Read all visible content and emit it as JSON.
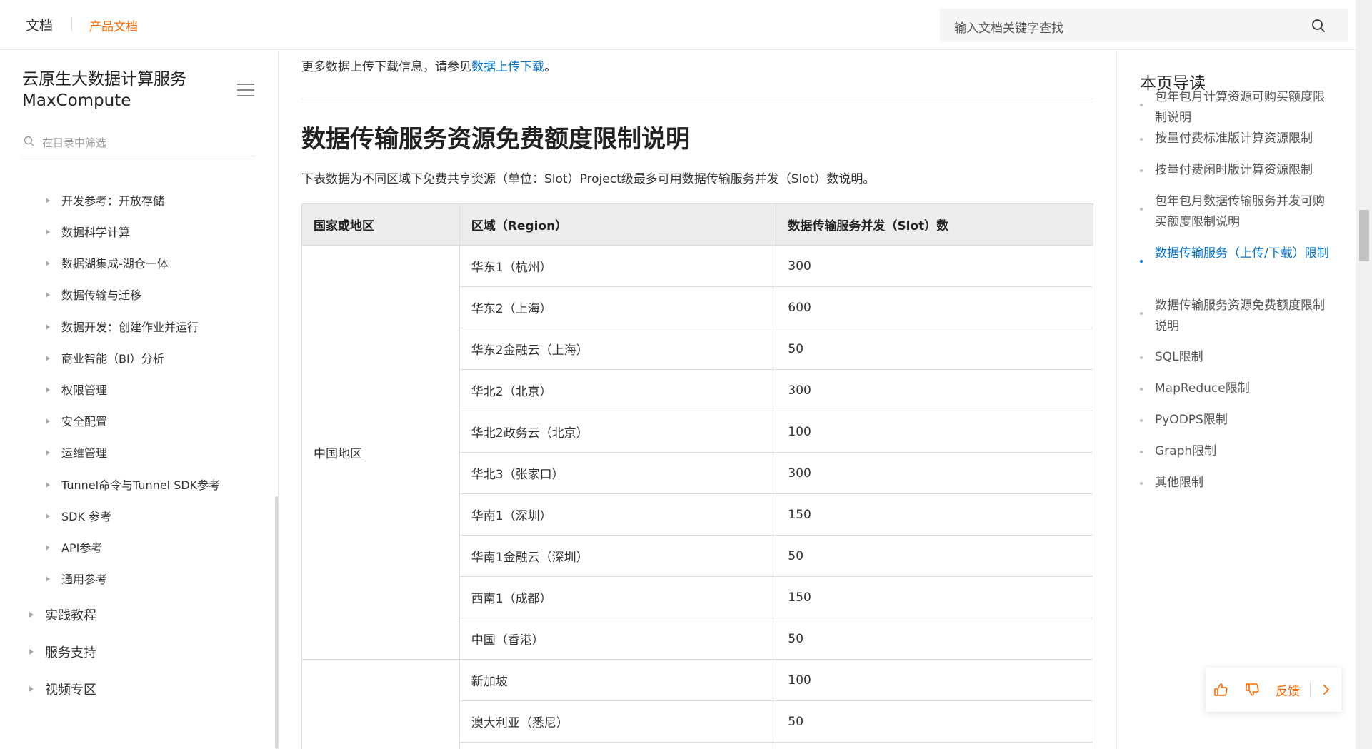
{
  "topbar": {
    "brand": "文档",
    "product": "产品文档",
    "search_placeholder": "输入文档关键字查找",
    "search_icon": "search-icon"
  },
  "sidebar": {
    "title_line1": "云原生大数据计算服务",
    "title_line2": "MaxCompute",
    "filter_placeholder": "在目录中筛选",
    "items": [
      {
        "label": "开发参考：开放存储"
      },
      {
        "label": "数据科学计算"
      },
      {
        "label": "数据湖集成-湖仓一体"
      },
      {
        "label": "数据传输与迁移"
      },
      {
        "label": "数据开发：创建作业并运行"
      },
      {
        "label": "商业智能（BI）分析"
      },
      {
        "label": "权限管理"
      },
      {
        "label": "安全配置"
      },
      {
        "label": "运维管理"
      },
      {
        "label": "Tunnel命令与Tunnel SDK参考"
      },
      {
        "label": "SDK 参考"
      },
      {
        "label": "API参考"
      },
      {
        "label": "通用参考"
      }
    ],
    "top_items": [
      {
        "label": "实践教程"
      },
      {
        "label": "服务支持"
      },
      {
        "label": "视频专区"
      }
    ]
  },
  "main": {
    "more_prefix": "更多数据上传下载信息，请参见",
    "more_link": "数据上传下载",
    "more_suffix": "。",
    "heading": "数据传输服务资源免费额度限制说明",
    "description": "下表数据为不同区域下免费共享资源（单位：Slot）Project级最多可用数据传输服务并发（Slot）数说明。",
    "table": {
      "headers": [
        "国家或地区",
        "区域（Region）",
        "数据传输服务并发（Slot）数"
      ],
      "group1_label": "中国地区",
      "group1_rows": [
        {
          "region": "华东1（杭州）",
          "slots": "300"
        },
        {
          "region": "华东2（上海）",
          "slots": "600"
        },
        {
          "region": "华东2金融云（上海）",
          "slots": "50"
        },
        {
          "region": "华北2（北京）",
          "slots": "300"
        },
        {
          "region": "华北2政务云（北京）",
          "slots": "100"
        },
        {
          "region": "华北3（张家口）",
          "slots": "300"
        },
        {
          "region": "华南1（深圳）",
          "slots": "150"
        },
        {
          "region": "华南1金融云（深圳）",
          "slots": "50"
        },
        {
          "region": "西南1（成都）",
          "slots": "150"
        },
        {
          "region": "中国（香港）",
          "slots": "50"
        }
      ],
      "group2_label": "",
      "group2_rows": [
        {
          "region": "新加坡",
          "slots": "100"
        },
        {
          "region": "澳大利亚（悉尼）",
          "slots": "50"
        }
      ]
    }
  },
  "toc": {
    "title": "本页导读",
    "items": [
      {
        "label": "包年包月计算资源可购买额度限制说明",
        "active": false
      },
      {
        "label": "按量付费标准版计算资源限制",
        "active": false
      },
      {
        "label": "按量付费闲时版计算资源限制",
        "active": false
      },
      {
        "label": "包年包月数据传输服务并发可购买额度限制说明",
        "active": false
      },
      {
        "label": "数据传输服务（上传/下载）限制",
        "active": true
      },
      {
        "label": "数据传输服务资源免费额度限制说明",
        "active": false
      },
      {
        "label": "SQL限制",
        "active": false
      },
      {
        "label": "MapReduce限制",
        "active": false
      },
      {
        "label": "PyODPS限制",
        "active": false
      },
      {
        "label": "Graph限制",
        "active": false
      },
      {
        "label": "其他限制",
        "active": false
      }
    ]
  },
  "feedback": {
    "label": "反馈",
    "like_icon": "thumbs-up-icon",
    "dislike_icon": "thumbs-down-icon",
    "next_icon": "chevron-right-icon"
  },
  "colors": {
    "accent": "#ff6a00",
    "link": "#0070cc"
  }
}
